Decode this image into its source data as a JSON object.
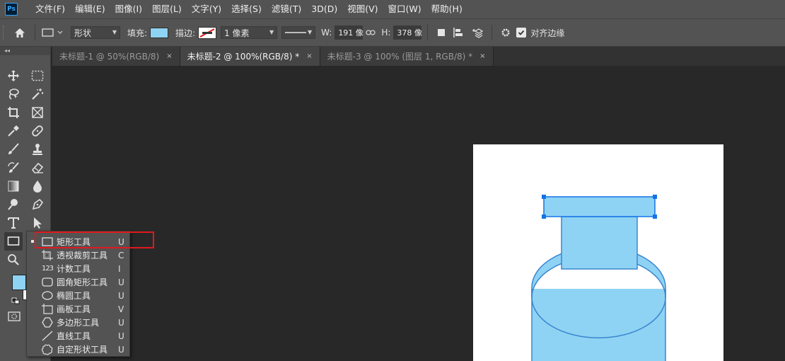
{
  "app": {
    "logo": "Ps"
  },
  "menu": [
    "文件(F)",
    "编辑(E)",
    "图像(I)",
    "图层(L)",
    "文字(Y)",
    "选择(S)",
    "滤镜(T)",
    "3D(D)",
    "视图(V)",
    "窗口(W)",
    "帮助(H)"
  ],
  "options": {
    "mode_value": "形状",
    "fill_label": "填充:",
    "fill_color": "#8fd3f4",
    "stroke_label": "描边:",
    "stroke_width": "1 像素",
    "w_label": "W:",
    "w_value": "191 像",
    "h_label": "H:",
    "h_value": "378 像",
    "align_edges_label": "对齐边缘",
    "align_edges_checked": true
  },
  "tabs": [
    {
      "label": "未标题-1 @ 50%(RGB/8)",
      "close": "×",
      "active": false
    },
    {
      "label": "未标题-2 @ 100%(RGB/8) *",
      "close": "×",
      "active": true
    },
    {
      "label": "未标题-3 @ 100% (图层 1, RGB/8) *",
      "close": "×",
      "active": false
    }
  ],
  "toolbar": {
    "collapse": "◂◂",
    "foreground_color": "#8fd3f4",
    "background_color": "#ffffff"
  },
  "flyout": {
    "items": [
      {
        "label": "矩形工具",
        "key": "U",
        "icon": "rectangle-icon",
        "active": true
      },
      {
        "label": "透视裁剪工具",
        "key": "C",
        "icon": "perspective-crop-icon"
      },
      {
        "label": "计数工具",
        "key": "I",
        "icon": "count-icon"
      },
      {
        "label": "圆角矩形工具",
        "key": "U",
        "icon": "rounded-rect-icon"
      },
      {
        "label": "椭圆工具",
        "key": "U",
        "icon": "ellipse-icon"
      },
      {
        "label": "画板工具",
        "key": "V",
        "icon": "artboard-icon"
      },
      {
        "label": "多边形工具",
        "key": "U",
        "icon": "polygon-icon"
      },
      {
        "label": "直线工具",
        "key": "U",
        "icon": "line-icon"
      },
      {
        "label": "自定形状工具",
        "key": "U",
        "icon": "custom-shape-icon"
      }
    ],
    "count_icon_text": "123"
  },
  "canvas": {
    "shape_fill": "#8fd3f4",
    "shape_stroke": "#3a86cf",
    "handle_color": "#1473e6"
  }
}
